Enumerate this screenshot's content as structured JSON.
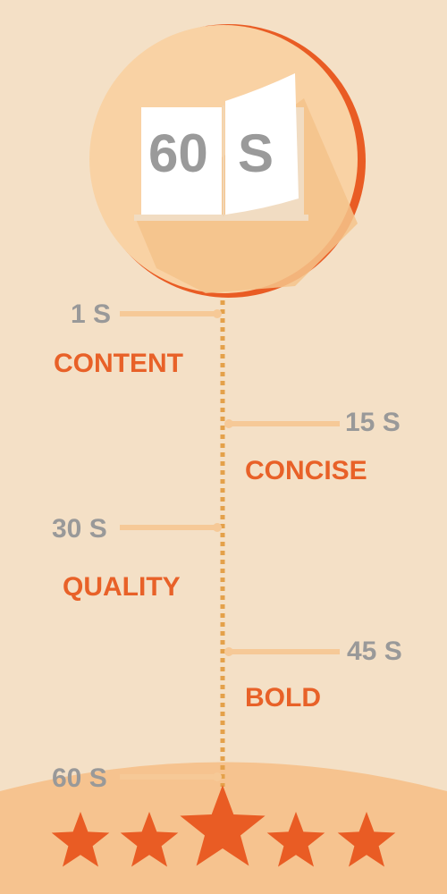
{
  "book": {
    "left_text": "60",
    "right_text": "S"
  },
  "timeline": [
    {
      "time": "1 S",
      "word": "CONTENT",
      "side": "left"
    },
    {
      "time": "15 S",
      "word": "CONCISE",
      "side": "right"
    },
    {
      "time": "30 S",
      "word": "QUALITY",
      "side": "left"
    },
    {
      "time": "45 S",
      "word": "BOLD",
      "side": "right"
    },
    {
      "time": "60 S",
      "word": "",
      "side": "left"
    }
  ],
  "rating": {
    "stars": 5,
    "max": 5
  },
  "colors": {
    "background": "#f4e0c6",
    "circle": "#f9d2a4",
    "circle_rim": "#e95c24",
    "accent_orange": "#e86128",
    "time_gray": "#999999",
    "tick": "#f6c997",
    "dotted_line": "#e4a14a",
    "star": "#e95c24",
    "ground": "#f6c38f"
  },
  "icons": {
    "book": "open-book-icon",
    "star": "star-icon"
  }
}
